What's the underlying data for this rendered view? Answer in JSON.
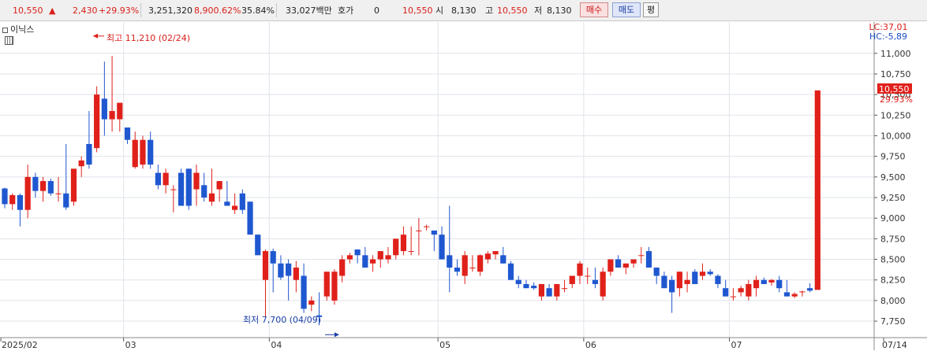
{
  "topbar": {
    "price": "10,550",
    "change": "2,430",
    "change_pct": "+29.93%",
    "volume": "3,251,320",
    "volume_ratio": "8,900.62%",
    "turnover": "35.84%",
    "amount": "33,027백만",
    "quote_label": "호가",
    "quote_value": "0",
    "quote_price": "10,550",
    "open_label": "시",
    "open_value": "8,130",
    "high_label": "고",
    "high_value": "10,550",
    "low_label": "저",
    "low_value": "8,130",
    "buy_button": "매수",
    "sell_button": "매도",
    "eval_button": "평"
  },
  "stock_name": "이닉스",
  "colors": {
    "up": "#e0201a",
    "down": "#1f57d0",
    "grid": "#dfe3ea"
  },
  "annotations": {
    "high": "최고 11,210 (02/24)",
    "low": "최저 7,700 (04/09)",
    "lc": "LC:37,01",
    "hc": "HC:-5,89",
    "last_price": "10,550",
    "last_pct": "29.93%"
  },
  "chart_data": {
    "type": "candlestick",
    "ylim": [
      7550,
      11380
    ],
    "y_ticks": [
      7750,
      8000,
      8250,
      8500,
      8750,
      9000,
      9250,
      9500,
      9750,
      10000,
      10250,
      10500,
      10750,
      11000
    ],
    "y_tick_labels": [
      "7,750",
      "8,000",
      "8,250",
      "8,500",
      "8,750",
      "9,000",
      "9,250",
      "9,500",
      "9,750",
      "10,000",
      "10,250",
      "10,500",
      "10,750",
      "11,000"
    ],
    "x_labels": [
      {
        "label": "2025/02",
        "i": 0
      },
      {
        "label": "03",
        "i": 16
      },
      {
        "label": "04",
        "i": 35
      },
      {
        "label": "05",
        "i": 57
      },
      {
        "label": "06",
        "i": 76
      },
      {
        "label": "07",
        "i": 95
      },
      {
        "label": "07/14",
        "i": 109
      }
    ],
    "candles": [
      [
        9360,
        9370,
        9120,
        9170
      ],
      [
        9170,
        9300,
        9100,
        9280
      ],
      [
        9280,
        9300,
        8900,
        9100
      ],
      [
        9100,
        9650,
        9000,
        9500
      ],
      [
        9500,
        9550,
        9250,
        9330
      ],
      [
        9330,
        9500,
        9200,
        9450
      ],
      [
        9450,
        9480,
        9270,
        9300
      ],
      [
        9300,
        9500,
        9200,
        9300
      ],
      [
        9300,
        9900,
        9100,
        9130
      ],
      [
        9200,
        9600,
        9150,
        9600
      ],
      [
        9630,
        9750,
        9500,
        9700
      ],
      [
        9900,
        10300,
        9600,
        9650
      ],
      [
        9850,
        10600,
        9800,
        10500
      ],
      [
        10450,
        10900,
        10000,
        10200
      ],
      [
        10200,
        10970,
        10050,
        10300
      ],
      [
        10200,
        10350,
        10050,
        10400
      ],
      [
        10100,
        10100,
        9900,
        9950
      ],
      [
        9620,
        10050,
        9600,
        9950
      ],
      [
        9650,
        10000,
        9600,
        9950
      ],
      [
        9950,
        10050,
        9600,
        9650
      ],
      [
        9550,
        9650,
        9350,
        9400
      ],
      [
        9400,
        9600,
        9300,
        9550
      ],
      [
        9350,
        9400,
        9070,
        9350
      ],
      [
        9550,
        9600,
        9200,
        9150
      ],
      [
        9600,
        9600,
        9100,
        9150
      ],
      [
        9350,
        9650,
        9150,
        9550
      ],
      [
        9400,
        9550,
        9200,
        9250
      ],
      [
        9200,
        9600,
        9150,
        9300
      ],
      [
        9350,
        9450,
        9200,
        9450
      ],
      [
        9200,
        9450,
        9150,
        9150
      ],
      [
        9100,
        9300,
        9050,
        9150
      ],
      [
        9300,
        9350,
        9050,
        9100
      ],
      [
        9200,
        9200,
        8800,
        8800
      ],
      [
        8800,
        8800,
        8550,
        8550
      ],
      [
        8250,
        8620,
        7800,
        8600
      ],
      [
        8600,
        8630,
        8100,
        8450
      ],
      [
        8450,
        8550,
        8250,
        8280
      ],
      [
        8450,
        8500,
        8000,
        8300
      ],
      [
        8250,
        8480,
        8100,
        8400
      ],
      [
        8300,
        8450,
        7850,
        7900
      ],
      [
        7950,
        8050,
        7870,
        8000
      ],
      [
        7820,
        8100,
        7700,
        7800
      ],
      [
        8050,
        8350,
        8000,
        8350
      ],
      [
        8000,
        8380,
        7950,
        8350
      ],
      [
        8300,
        8550,
        8220,
        8500
      ],
      [
        8500,
        8580,
        8450,
        8550
      ],
      [
        8620,
        8620,
        8450,
        8550
      ],
      [
        8550,
        8650,
        8450,
        8400
      ],
      [
        8450,
        8550,
        8350,
        8500
      ],
      [
        8500,
        8580,
        8400,
        8600
      ],
      [
        8500,
        8650,
        8450,
        8550
      ],
      [
        8550,
        8750,
        8500,
        8750
      ],
      [
        8600,
        8900,
        8550,
        8800
      ],
      [
        8600,
        8900,
        8550,
        8600
      ],
      [
        8850,
        9000,
        8550,
        8850
      ],
      [
        8900,
        8920,
        8850,
        8900
      ],
      [
        8850,
        8850,
        8600,
        8800
      ],
      [
        8800,
        8900,
        8650,
        8500
      ],
      [
        8550,
        9150,
        8100,
        8400
      ],
      [
        8400,
        8500,
        8300,
        8350
      ],
      [
        8300,
        8600,
        8200,
        8550
      ],
      [
        8400,
        8550,
        8350,
        8400
      ],
      [
        8350,
        8560,
        8300,
        8550
      ],
      [
        8500,
        8600,
        8450,
        8570
      ],
      [
        8560,
        8600,
        8500,
        8600
      ],
      [
        8550,
        8650,
        8450,
        8450
      ],
      [
        8450,
        8480,
        8250,
        8250
      ],
      [
        8250,
        8300,
        8150,
        8200
      ],
      [
        8200,
        8250,
        8150,
        8150
      ],
      [
        8180,
        8220,
        8130,
        8150
      ],
      [
        8050,
        8200,
        8000,
        8200
      ],
      [
        8150,
        8200,
        8050,
        8050
      ],
      [
        8050,
        8150,
        8000,
        8200
      ],
      [
        8150,
        8250,
        8100,
        8150
      ],
      [
        8200,
        8300,
        8150,
        8300
      ],
      [
        8300,
        8480,
        8200,
        8450
      ],
      [
        8300,
        8400,
        8200,
        8300
      ],
      [
        8250,
        8400,
        8150,
        8200
      ],
      [
        8050,
        8400,
        8000,
        8350
      ],
      [
        8350,
        8500,
        8300,
        8500
      ],
      [
        8500,
        8550,
        8400,
        8400
      ],
      [
        8400,
        8450,
        8320,
        8450
      ],
      [
        8450,
        8480,
        8400,
        8500
      ],
      [
        8550,
        8650,
        8450,
        8550
      ],
      [
        8600,
        8650,
        8550,
        8400
      ],
      [
        8400,
        8400,
        8200,
        8300
      ],
      [
        8300,
        8350,
        8150,
        8150
      ],
      [
        8250,
        8300,
        7850,
        8100
      ],
      [
        8150,
        8350,
        8050,
        8350
      ],
      [
        8200,
        8350,
        8100,
        8250
      ],
      [
        8350,
        8380,
        8250,
        8200
      ],
      [
        8300,
        8450,
        8250,
        8350
      ],
      [
        8350,
        8380,
        8300,
        8320
      ],
      [
        8300,
        8320,
        8150,
        8200
      ],
      [
        8150,
        8250,
        8050,
        8050
      ],
      [
        8050,
        8150,
        8000,
        8050
      ],
      [
        8100,
        8180,
        8050,
        8150
      ],
      [
        8050,
        8250,
        8000,
        8200
      ],
      [
        8150,
        8300,
        8050,
        8250
      ],
      [
        8250,
        8280,
        8200,
        8200
      ],
      [
        8220,
        8260,
        8180,
        8250
      ],
      [
        8250,
        8300,
        8100,
        8150
      ],
      [
        8100,
        8250,
        8050,
        8050
      ],
      [
        8050,
        8100,
        8030,
        8080
      ],
      [
        8100,
        8120,
        8050,
        8110
      ],
      [
        8150,
        8210,
        8100,
        8120
      ],
      [
        8130,
        10550,
        8130,
        10550
      ]
    ]
  }
}
